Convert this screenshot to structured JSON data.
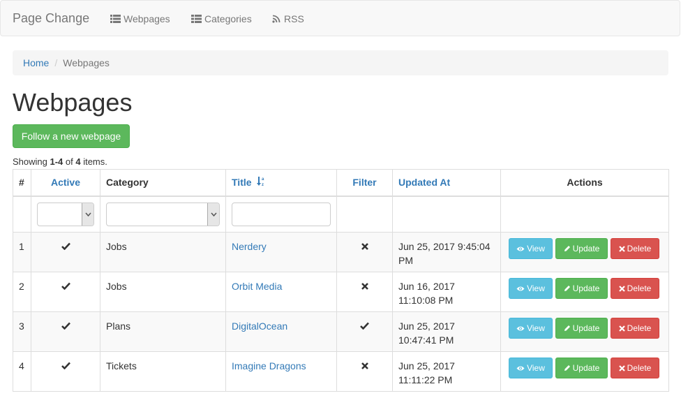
{
  "navbar": {
    "brand": "Page Change",
    "items": [
      {
        "label": "Webpages",
        "icon": "list-icon"
      },
      {
        "label": "Categories",
        "icon": "th-list-icon"
      },
      {
        "label": "RSS",
        "icon": "rss-icon"
      }
    ]
  },
  "breadcrumb": {
    "home": "Home",
    "separator": "/",
    "current": "Webpages"
  },
  "page": {
    "title": "Webpages",
    "follow_button": "Follow a new webpage",
    "summary": {
      "prefix": "Showing ",
      "range": "1-4",
      "mid": " of ",
      "total": "4",
      "suffix": " items."
    }
  },
  "table": {
    "headers": {
      "num": "#",
      "active": "Active",
      "category": "Category",
      "title": "Title",
      "filter": "Filter",
      "updated_at": "Updated At",
      "actions": "Actions"
    },
    "title_sort": "ascending",
    "rows": [
      {
        "num": "1",
        "active": true,
        "category": "Jobs",
        "title": "Nerdery",
        "filter": false,
        "updated_line1": "Jun 25, 2017 9:45:04",
        "updated_line2": "PM"
      },
      {
        "num": "2",
        "active": true,
        "category": "Jobs",
        "title": "Orbit Media",
        "filter": false,
        "updated_line1": "Jun 16, 2017",
        "updated_line2": "11:10:08 PM"
      },
      {
        "num": "3",
        "active": true,
        "category": "Plans",
        "title": "DigitalOcean",
        "filter": true,
        "updated_line1": "Jun 25, 2017",
        "updated_line2": "10:47:41 PM"
      },
      {
        "num": "4",
        "active": true,
        "category": "Tickets",
        "title": "Imagine Dragons",
        "filter": false,
        "updated_line1": "Jun 25, 2017",
        "updated_line2": "11:11:22 PM"
      }
    ],
    "action_labels": {
      "view": "View",
      "update": "Update",
      "delete": "Delete"
    }
  },
  "colors": {
    "link": "#337ab7",
    "success": "#5cb85c",
    "info": "#5bc0de",
    "danger": "#d9534f"
  }
}
